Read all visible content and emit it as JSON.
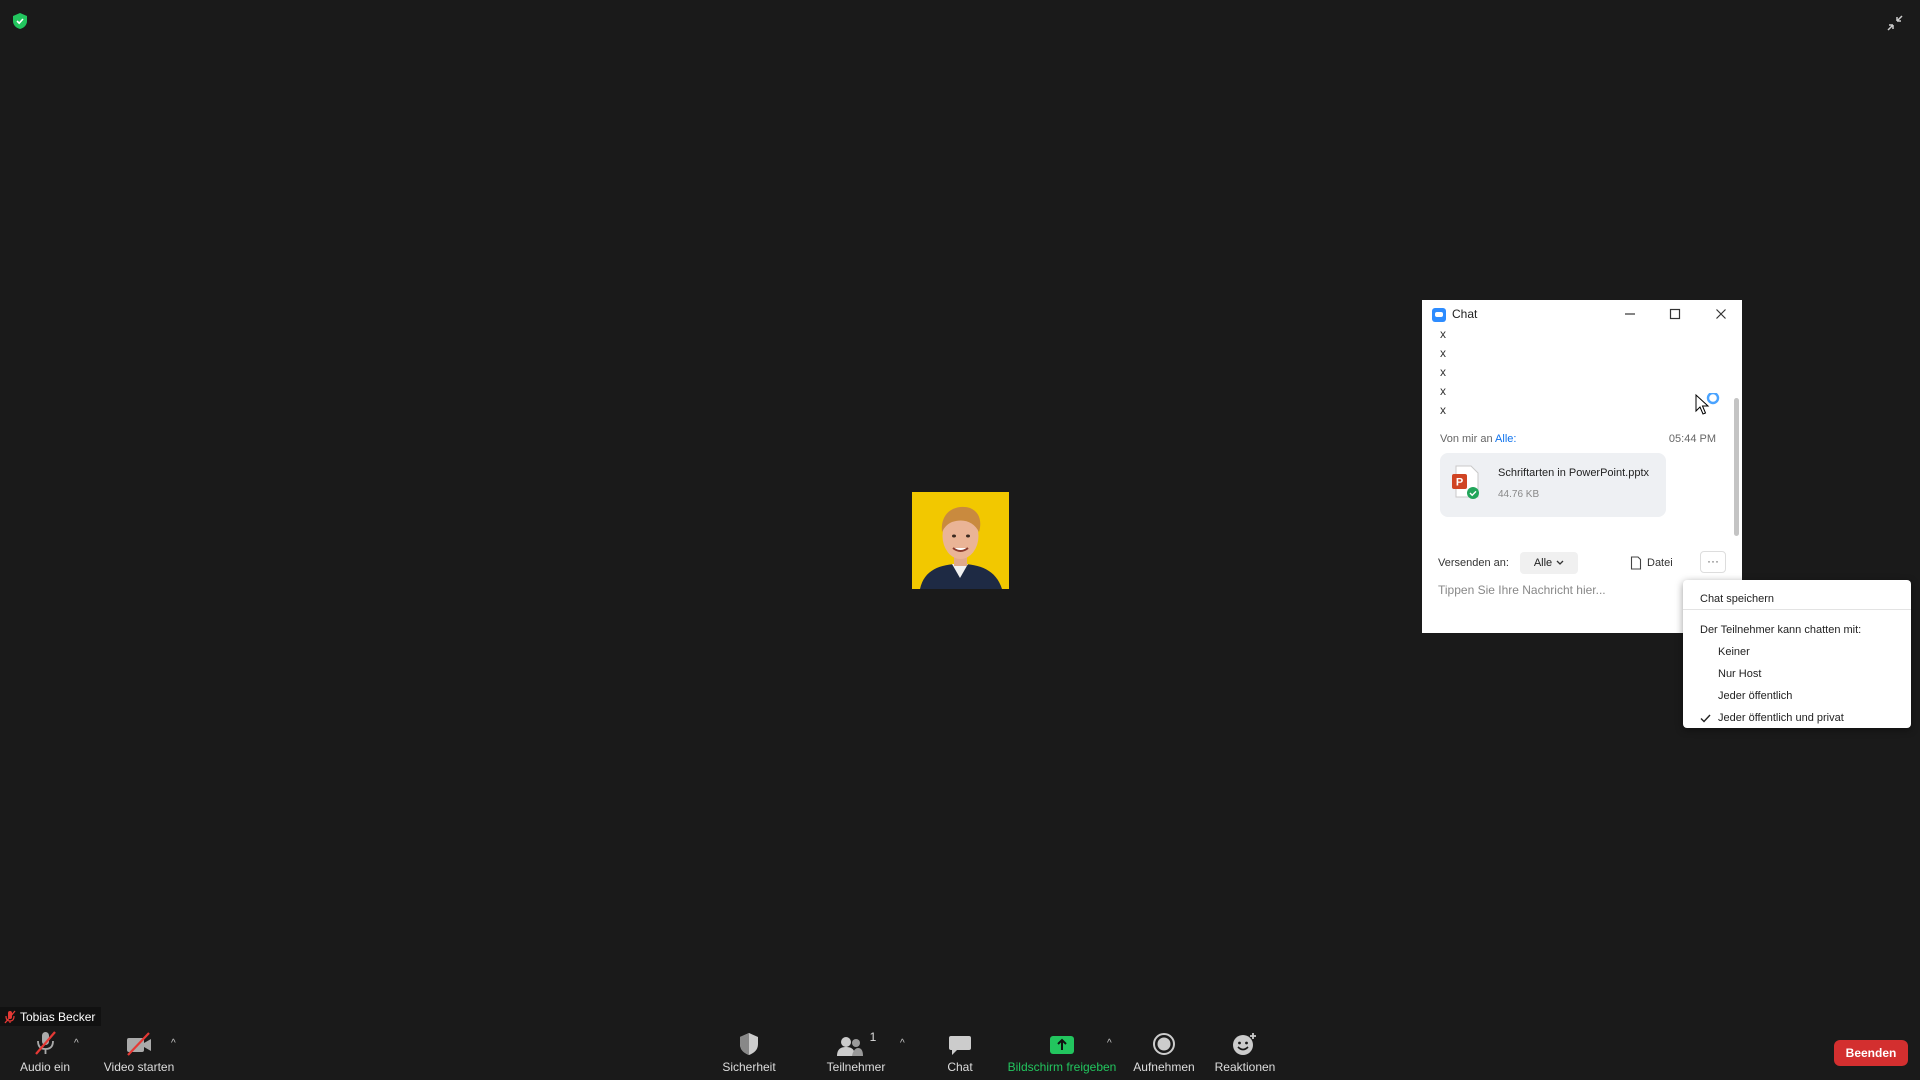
{
  "chat": {
    "title": "Chat",
    "messages": [
      "x",
      "x",
      "x",
      "x",
      "x"
    ],
    "last_message": {
      "from_prefix": "Von mir an",
      "to": "Alle:",
      "time": "05:44 PM",
      "file": {
        "name": "Schriftarten in PowerPoint.pptx",
        "size": "44.76 KB"
      }
    },
    "send_to_label": "Versenden an:",
    "recipient": "Alle",
    "file_button": "Datei",
    "more_button": "···",
    "input_placeholder": "Tippen Sie Ihre Nachricht hier..."
  },
  "menu": {
    "save_chat": "Chat speichern",
    "heading": "Der Teilnehmer kann chatten mit:",
    "options": [
      "Keiner",
      "Nur Host",
      "Jeder öffentlich",
      "Jeder öffentlich und privat"
    ],
    "checked_option": "Jeder öffentlich und privat"
  },
  "participant": {
    "name": "Tobias Becker"
  },
  "toolbar": {
    "audio": "Audio ein",
    "video": "Video starten",
    "security": "Sicherheit",
    "participants": "Teilnehmer",
    "participants_count": "1",
    "chat": "Chat",
    "share": "Bildschirm freigeben",
    "record": "Aufnehmen",
    "reactions": "Reaktionen",
    "end": "Beenden"
  },
  "colors": {
    "share_green": "#22c55e",
    "end_red": "#d32f2f",
    "link_blue": "#0e72ed",
    "avatar_bg": "#f2c800"
  }
}
